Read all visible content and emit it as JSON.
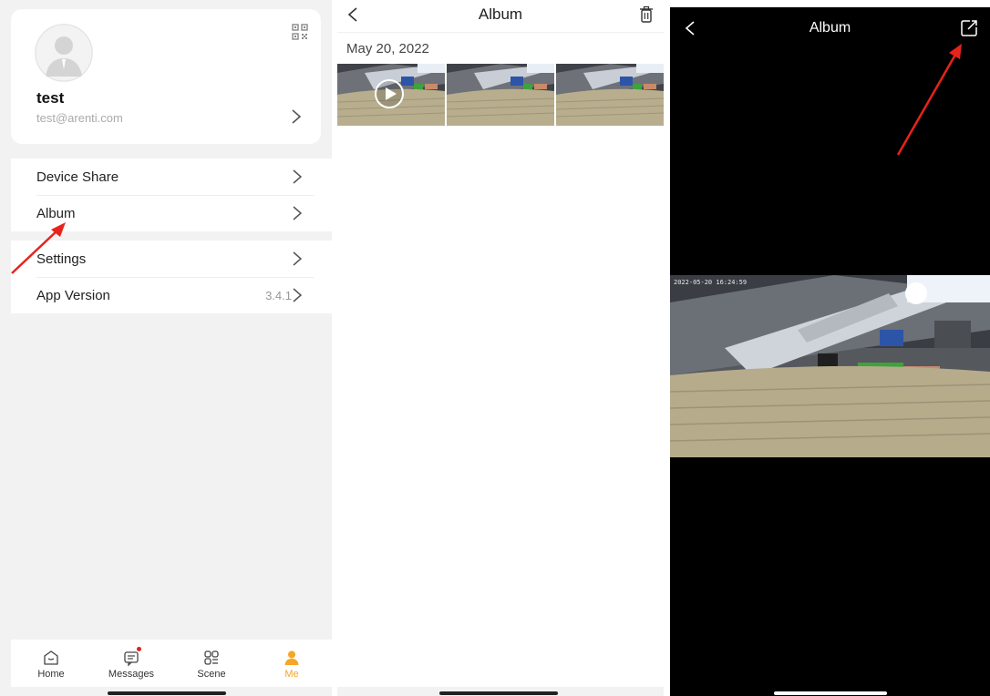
{
  "me_page": {
    "user_name": "test",
    "user_email": "test@arenti.com",
    "menu_group1": [
      {
        "label": "Device Share"
      },
      {
        "label": "Album"
      }
    ],
    "menu_group2": [
      {
        "label": "Settings",
        "value": ""
      },
      {
        "label": "App Version",
        "value": "3.4.1"
      }
    ],
    "tabs": [
      {
        "label": "Home",
        "icon": "home-icon"
      },
      {
        "label": "Messages",
        "icon": "messages-icon"
      },
      {
        "label": "Scene",
        "icon": "scene-icon"
      },
      {
        "label": "Me",
        "icon": "me-icon"
      }
    ],
    "active_tab": "Me",
    "accent_color": "#f5a623"
  },
  "album_list": {
    "title": "Album",
    "date": "May 20, 2022",
    "thumbnail_count": 3
  },
  "album_viewer": {
    "title": "Album",
    "timestamp": "2022-05-20 16:24:59"
  },
  "annotation_color": "#e8231b"
}
